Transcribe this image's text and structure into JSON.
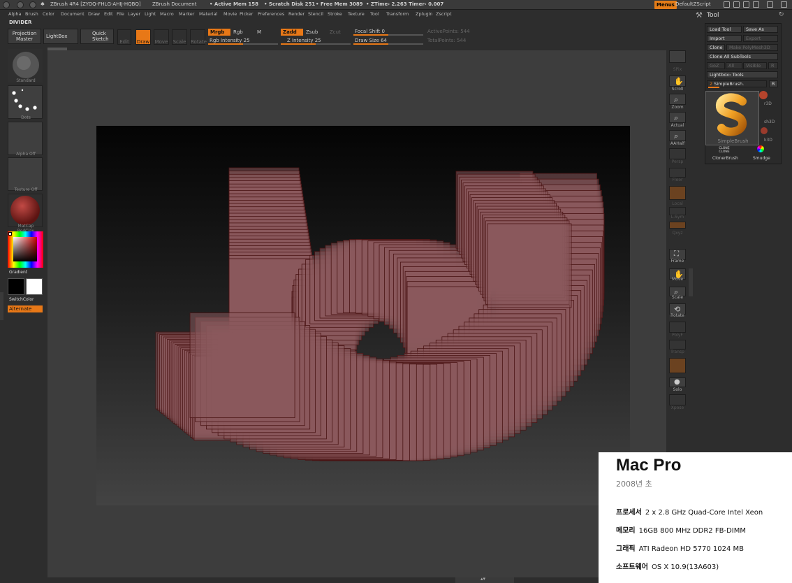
{
  "titlebar": {
    "app": "ZBrush 4R4 [ZYOQ-FHLG-AHIJ-HQBQ]",
    "doc": "ZBrush Document",
    "active_mem": "• Active Mem 158",
    "scratch": "• Scratch Disk 251",
    "free_mem": "• Free Mem 3089",
    "ztime": "• ZTime› 2.263 Timer› 0.007",
    "menus": "Menus",
    "zscript": "DefaultZScript"
  },
  "menubar": [
    "Alpha",
    "Brush",
    "Color",
    "Document",
    "Draw",
    "Edit",
    "File",
    "Layer",
    "Light",
    "Macro",
    "Marker",
    "Material",
    "Movie",
    "Picker",
    "Preferences",
    "Render",
    "Stencil",
    "Stroke",
    "Texture",
    "Tool",
    "Transform",
    "Zplugin",
    "Zscript"
  ],
  "divider": "DIVIDER",
  "shelf": {
    "projection_master": "Projection Master",
    "lightbox": "LightBox",
    "quick_sketch": "Quick Sketch",
    "edit": "Edit",
    "draw": "Draw",
    "move": "Move",
    "scale": "Scale",
    "rotate": "Rotate",
    "mrgb": "Mrgb",
    "rgb": "Rgb",
    "m": "M",
    "rgb_intensity": "Rgb Intensity 25",
    "zadd": "Zadd",
    "zsub": "Zsub",
    "zcut": "Zcut",
    "z_intensity": "Z Intensity 25",
    "focal_shift": "Focal Shift 0",
    "draw_size": "Draw Size 64",
    "active_points": "ActivePoints: 544",
    "total_points": "TotalPoints: 544"
  },
  "left": {
    "brush": "Standard",
    "stroke": "Dots",
    "alpha": "Alpha Off",
    "texture": "Texture Off",
    "material": "MatCap RedClay",
    "gradient": "Gradient",
    "switch_color": "SwitchColor",
    "alternate": "Alternate"
  },
  "right": {
    "bpr": "BPR",
    "spix": "SPix",
    "scroll": "Scroll",
    "zoom": "Zoom",
    "actual": "Actual",
    "aahalf": "AAHalf",
    "persp": "Persp",
    "floor": "Floor",
    "local": "Local",
    "lsym": "L.Sym",
    "xyz": "Qxyz",
    "frame": "Frame",
    "move": "Move",
    "scale": "Scale",
    "rotate": "Rotate",
    "polyf": "PolyF",
    "transp": "Transp",
    "ghost": "Ghost",
    "solo": "Solo",
    "xpose": "Xpose"
  },
  "tool": {
    "title": "Tool",
    "load_tool": "Load Tool",
    "save_as": "Save As",
    "import": "Import",
    "export": "Export",
    "clone": "Clone",
    "make_polymesh": "Make PolyMesh3D",
    "clone_all": "Clone All SubTools",
    "goz": "GoZ",
    "all": "All",
    "visible": "Visible",
    "r": "R",
    "lightbox_tools": "Lightbox› Tools",
    "simplebrush_value": "2",
    "simplebrush_label": "SimpleBrush.",
    "r2": "R",
    "thumb_caption": "SimpleBrush",
    "sphere": "r3D",
    "sh3d": "sh3D",
    "k3d": "k3D",
    "cloner": "ClonerBrush",
    "smudge": "Smudge",
    "clone_glyph": "CLONE"
  },
  "info": {
    "title": "Mac Pro",
    "subtitle": "2008년 초",
    "specs": [
      {
        "label": "프로세서",
        "value": "2 x 2.8 GHz Quad-Core Intel Xeon"
      },
      {
        "label": "메모리",
        "value": "16GB 800 MHz DDR2 FB-DIMM"
      },
      {
        "label": "그래픽",
        "value": "ATI Radeon HD 5770 1024 MB"
      },
      {
        "label": "소프트웨어",
        "value": "OS X 10.9(13A603)"
      }
    ]
  },
  "colors": {
    "accent": "#e87817",
    "mesh_fill": "#8a5a5c",
    "mesh_edge": "#4a1414"
  }
}
